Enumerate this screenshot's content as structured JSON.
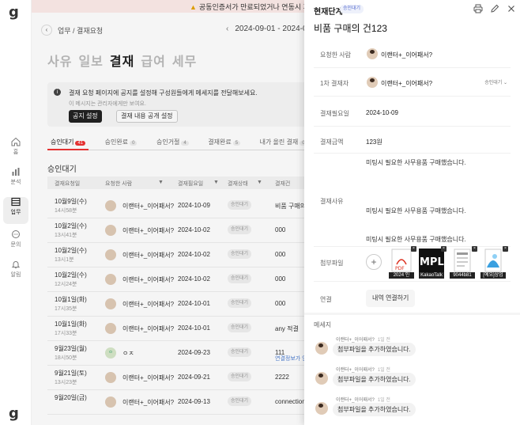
{
  "app": {
    "logo": "g"
  },
  "rail": [
    {
      "id": "home",
      "label": "홈",
      "icon": "home-icon"
    },
    {
      "id": "analysis",
      "label": "분석",
      "icon": "bar-chart-icon"
    },
    {
      "id": "work",
      "label": "업무",
      "icon": "table-icon",
      "active": true
    },
    {
      "id": "inquiry",
      "label": "문의",
      "icon": "chat-icon"
    },
    {
      "id": "alert",
      "label": "알림",
      "icon": "bell-icon"
    }
  ],
  "banner": {
    "text": "공동인증서가 만료되었거나 연동시 계정"
  },
  "breadcrumb": "업무 / 결재요청",
  "date_range": "2024-09-01 - 2024-0",
  "big_tabs": [
    {
      "label": "사유"
    },
    {
      "label": "일보"
    },
    {
      "label": "결재",
      "active": true
    },
    {
      "label": "급여"
    },
    {
      "label": "세무"
    }
  ],
  "notice": {
    "line1": "결재 요청 페이지에 공지를 설정해 구성원들에게 메세지를 전달해보세요.",
    "line2": "이 메시지는 관리자에게만 보여요.",
    "btn_notice": "공지 설정",
    "btn_public": "결재 내용 공개 설정"
  },
  "sub_tabs": [
    {
      "label": "승인대기",
      "count": "41",
      "active": true
    },
    {
      "label": "승인완료",
      "count": "0"
    },
    {
      "label": "승인거절",
      "count": "4"
    },
    {
      "label": "결재완료",
      "count": "5"
    },
    {
      "label": "내가 올린 결재",
      "count": "0"
    }
  ],
  "section_title": "승인대기",
  "table_headers": [
    "결재요청일",
    "요청한 사람",
    "결재필요일",
    "결재상태",
    "결재건"
  ],
  "rows": [
    {
      "date": "10월9일(수)",
      "time": "14시58분",
      "name": "이랜터+_이어패서?",
      "due": "2024-10-09",
      "status": "승인대기",
      "title": "비품 구매의",
      "title2": "",
      "avatar": "photo"
    },
    {
      "date": "10월2일(수)",
      "time": "13시41분",
      "name": "이랜터+_이어패서?",
      "due": "2024-10-02",
      "status": "승인대기",
      "title": "000",
      "title2": "",
      "avatar": "photo"
    },
    {
      "date": "10월2일(수)",
      "time": "13시1분",
      "name": "이랜터+_이어패서?",
      "due": "2024-10-02",
      "status": "승인대기",
      "title": "000",
      "title2": "",
      "avatar": "photo"
    },
    {
      "date": "10월2일(수)",
      "time": "12시24분",
      "name": "이랜터+_이어패서?",
      "due": "2024-10-02",
      "status": "승인대기",
      "title": "000",
      "title2": "",
      "avatar": "photo"
    },
    {
      "date": "10월1일(화)",
      "time": "17시35분",
      "name": "이랜터+_이어패서?",
      "due": "2024-10-01",
      "status": "승인대기",
      "title": "000",
      "title2": "",
      "avatar": "photo"
    },
    {
      "date": "10월1일(화)",
      "time": "17시33분",
      "name": "이랜터+_이어패서?",
      "due": "2024-10-01",
      "status": "승인대기",
      "title": "any 적결",
      "title2": "",
      "avatar": "photo"
    },
    {
      "date": "9월23일(월)",
      "time": "18시50분",
      "name": "ㅇㅈ",
      "due": "2024-09-23",
      "status": "승인대기",
      "title": "111",
      "title2": "연결정보가 연",
      "avatar": "initial"
    },
    {
      "date": "9월21일(토)",
      "time": "13시23분",
      "name": "이랜터+_이어패서?",
      "due": "2024-09-21",
      "status": "승인대기",
      "title": "2222",
      "title2": "",
      "avatar": "photo"
    },
    {
      "date": "9월20일(금)",
      "time": "",
      "name": "이랜터+_이어패서?",
      "due": "2024-09-13",
      "status": "승인대기",
      "title": "connection",
      "title2": "",
      "avatar": "photo"
    }
  ],
  "drawer": {
    "stage_label": "현재단계",
    "stage_badge": "승인대기",
    "title": "비품 구매의 건123",
    "requester_label": "요청한 사람",
    "requester_name": "이랜터+_이어패서?",
    "approver_label": "1차 결재자",
    "approver_name": "이랜터+_이어패서?",
    "approver_status": "승인대기",
    "due_label": "결재필요일",
    "due_value": "2024-10-09",
    "amount_label": "결재금액",
    "amount_value": "123원",
    "reason_label": "결재사유",
    "reason_lines": [
      "미팅시 필요한 사무용품 구매했습니다.",
      "미팅시 필요한 사무용품 구매했습니다.",
      "미팅시 필요한 사무용품 구매했습니다."
    ],
    "attach_label": "첨부파일",
    "files": [
      {
        "caption": "2024 인",
        "type": "pdf"
      },
      {
        "caption": "KakaoTalk",
        "type": "mpl"
      },
      {
        "caption": "9044b81",
        "type": "doc"
      },
      {
        "caption": "[예요]상업",
        "type": "image"
      }
    ],
    "link_label": "연결",
    "link_button": "내역 연결하기",
    "messages_title": "메세지",
    "messages": [
      {
        "author": "이랜터+_이어패서?",
        "when": "1일 전",
        "text": "첨부파일을 추가하였습니다."
      },
      {
        "author": "이랜터+_이어패서?",
        "when": "1일 전",
        "text": "첨부파일을 추가하였습니다."
      },
      {
        "author": "이랜터+_이어패서?",
        "when": "1일 전",
        "text": "첨부파일을 추가하였습니다."
      }
    ]
  }
}
